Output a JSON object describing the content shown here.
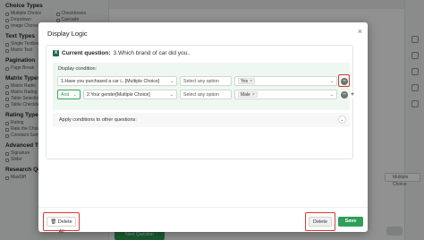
{
  "sidebar": {
    "sections": [
      {
        "title": "Choice Types",
        "items": [
          "Multiple Choice",
          "Checkboxes",
          "Dropdown",
          "Cascade",
          "Image Choice",
          "Ranking"
        ]
      },
      {
        "title": "Text Types",
        "items": [
          "Single Textbox",
          "Multi Textbox",
          "Matrix Text",
          "Comment Box"
        ]
      },
      {
        "title": "Pagination",
        "items": [
          "Page Break",
          "Description"
        ]
      },
      {
        "title": "Matrix Types",
        "items": [
          "Matrix Radio",
          "Matrix Checkbox",
          "Matrix Rating",
          "Matrix Dropdown",
          "Table Selection",
          "Table Dropdown",
          "Table Checkbox",
          "Table Textbox"
        ]
      },
      {
        "title": "Rating Types",
        "items": [
          "Rating",
          "NPS",
          "Rate the Choice",
          "Slider",
          "Constant Sum"
        ]
      },
      {
        "title": "Advanced Types",
        "items": [
          "Signature",
          "Upload",
          "Slider",
          "Date"
        ]
      },
      {
        "title": "Research Que...",
        "items": [
          "MaxDiff",
          "Conjoint Analysis"
        ]
      }
    ]
  },
  "background": {
    "select_value": "Multiple Choice",
    "green_button": "Next Question",
    "accent": "#2f9e58"
  },
  "modal": {
    "title": "Display Logic",
    "close_icon": "×",
    "current_question_label": "Current question:",
    "current_question_value": "3.Which brand of car did you..",
    "condition_title": "Display condition:",
    "conditions": [
      {
        "question": "1.Have you purchased a car i...[Multiple Choice]",
        "operator": "Select any option",
        "value_tag": "Yes"
      },
      {
        "connector": "And",
        "question": "2.Your gender[Multiple Choice]",
        "operator": "Select any option",
        "value_tag": "Male"
      }
    ],
    "apply_label": "Apply conditions to other questions:",
    "delete_all_label": "Delete All",
    "delete_label": "Delete",
    "save_label": "Save",
    "highlight_color": "#d83a34"
  }
}
